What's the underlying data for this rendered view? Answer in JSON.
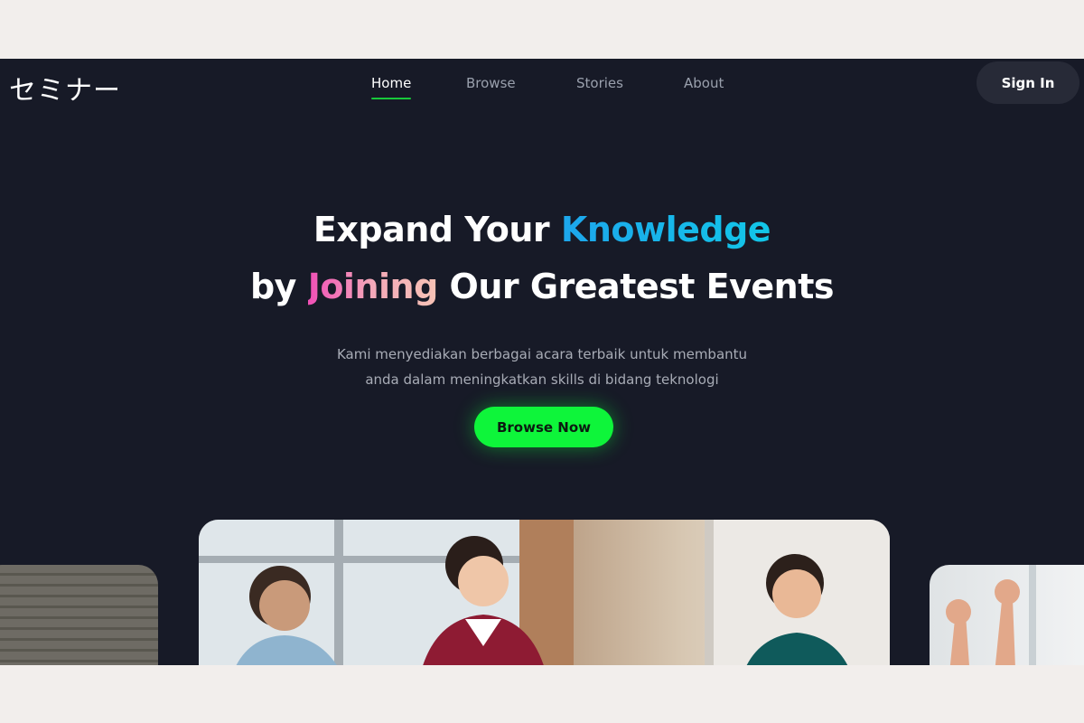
{
  "brand": {
    "logo": "セミナー"
  },
  "nav": {
    "links": [
      {
        "label": "Home",
        "active": true
      },
      {
        "label": "Browse",
        "active": false
      },
      {
        "label": "Stories",
        "active": false
      },
      {
        "label": "About",
        "active": false
      }
    ],
    "signin_label": "Sign In"
  },
  "hero": {
    "line1_prefix": "Expand Your ",
    "line1_accent": "Knowledge",
    "line2_prefix": "by ",
    "line2_accent": "Joining",
    "line2_suffix": " Our Greatest Events",
    "subtitle_line1": "Kami menyediakan berbagai acara terbaik untuk membantu",
    "subtitle_line2": "anda dalam meningkatkan skills di bidang teknologi",
    "cta_label": "Browse Now"
  },
  "colors": {
    "background": "#171a27",
    "accent_green": "#0ef53a",
    "accent_blue": "#1da6ec",
    "accent_pink": "#f04fb6"
  }
}
